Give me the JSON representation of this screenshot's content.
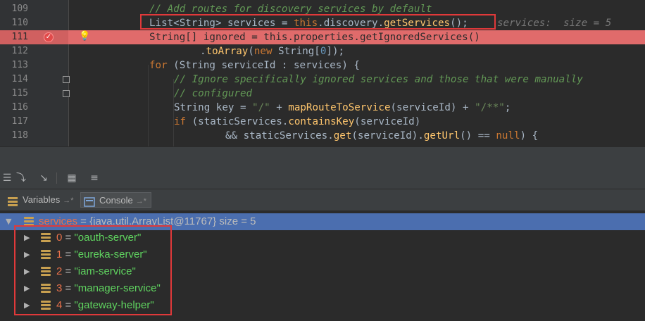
{
  "editor": {
    "lines": [
      {
        "num": "109"
      },
      {
        "num": "110"
      },
      {
        "num": "111"
      },
      {
        "num": "112"
      },
      {
        "num": "113"
      },
      {
        "num": "114"
      },
      {
        "num": "115"
      },
      {
        "num": "116"
      },
      {
        "num": "117"
      },
      {
        "num": "118"
      }
    ],
    "code": {
      "l109": "// Add routes for discovery services by default",
      "l110_a": "List<String> services = ",
      "l110_this": "this",
      "l110_b": ".discovery.",
      "l110_m": "getServices",
      "l110_c": "();",
      "l110_hint": "services:  size = 5",
      "l111": "String[] ignored = this.properties.getIgnoredServices()",
      "l112_a": ".",
      "l112_m": "toArray",
      "l112_b": "(",
      "l112_new": "new",
      "l112_c": " String[",
      "l112_num": "0",
      "l112_d": "]);",
      "l113_for": "for",
      "l113_b": " (String serviceId : services) {",
      "l114": "// Ignore specifically ignored services and those that were manually",
      "l115": "// configured",
      "l116_a": "String key = ",
      "l116_s1": "\"/\"",
      "l116_b": " + ",
      "l116_m": "mapRouteToService",
      "l116_c": "(serviceId) + ",
      "l116_s2": "\"/**\"",
      "l116_d": ";",
      "l117_if": "if",
      "l117_a": " (staticServices.",
      "l117_m": "containsKey",
      "l117_b": "(serviceId)",
      "l118_a": "&& staticServices.",
      "l118_m1": "get",
      "l118_b": "(serviceId).",
      "l118_m2": "getUrl",
      "l118_c": "() == ",
      "l118_null": "null",
      "l118_d": ") {"
    }
  },
  "tabs": {
    "variables": "Variables",
    "console": "Console",
    "pin": "→*"
  },
  "variables": {
    "root": {
      "name": "services",
      "eq": " = ",
      "value": "{java.util.ArrayList@11767}",
      "size": "  size = 5"
    },
    "items": [
      {
        "index": "0",
        "eq": " = ",
        "value": "\"oauth-server\""
      },
      {
        "index": "1",
        "eq": " = ",
        "value": "\"eureka-server\""
      },
      {
        "index": "2",
        "eq": " = ",
        "value": "\"iam-service\""
      },
      {
        "index": "3",
        "eq": " = ",
        "value": "\"manager-service\""
      },
      {
        "index": "4",
        "eq": " = ",
        "value": "\"gateway-helper\""
      }
    ]
  },
  "colors": {
    "breakpoint_line": "#e06b6b",
    "highlight_box": "#e0393a",
    "selected_row": "#4b6eaf"
  }
}
